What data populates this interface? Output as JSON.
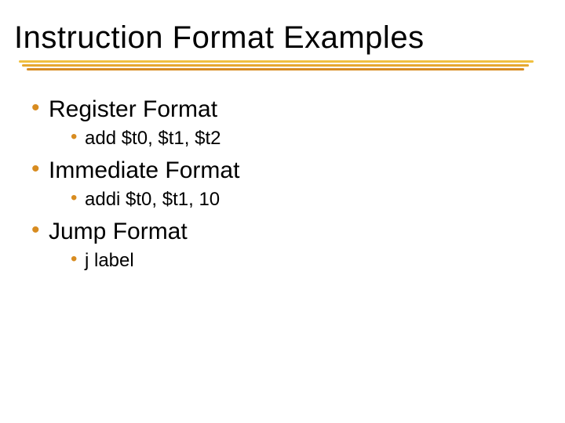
{
  "title": "Instruction Format Examples",
  "bullets": [
    {
      "label": "Register Format",
      "sub": "add $t0, $t1, $t2"
    },
    {
      "label": "Immediate Format",
      "sub": "addi $t0, $t1, 10"
    },
    {
      "label": "Jump Format",
      "sub": "j label"
    }
  ]
}
